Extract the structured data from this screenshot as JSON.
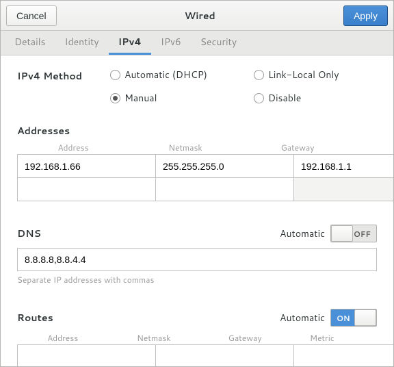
{
  "header": {
    "cancel": "Cancel",
    "title": "Wired",
    "apply": "Apply"
  },
  "tabs": {
    "details": "Details",
    "identity": "Identity",
    "ipv4": "IPv4",
    "ipv6": "IPv6",
    "security": "Security"
  },
  "method": {
    "label": "IPv4 Method",
    "auto": "Automatic (DHCP)",
    "linklocal": "Link-Local Only",
    "manual": "Manual",
    "disable": "Disable",
    "selected": "manual"
  },
  "addresses": {
    "title": "Addresses",
    "col_address": "Address",
    "col_netmask": "Netmask",
    "col_gateway": "Gateway",
    "rows": [
      {
        "address": "192.168.1.66",
        "netmask": "255.255.255.0",
        "gateway": "192.168.1.1"
      },
      {
        "address": "",
        "netmask": "",
        "gateway": ""
      }
    ]
  },
  "dns": {
    "title": "DNS",
    "automatic_label": "Automatic",
    "automatic_on": false,
    "value": "8.8.8.8,8.8.4.4",
    "hint": "Separate IP addresses with commas"
  },
  "routes": {
    "title": "Routes",
    "automatic_label": "Automatic",
    "automatic_on": true,
    "col_address": "Address",
    "col_netmask": "Netmask",
    "col_gateway": "Gateway",
    "col_metric": "Metric",
    "rows": [
      {
        "address": "",
        "netmask": "",
        "gateway": "",
        "metric": ""
      }
    ]
  },
  "switch_labels": {
    "on": "ON",
    "off": "OFF"
  }
}
